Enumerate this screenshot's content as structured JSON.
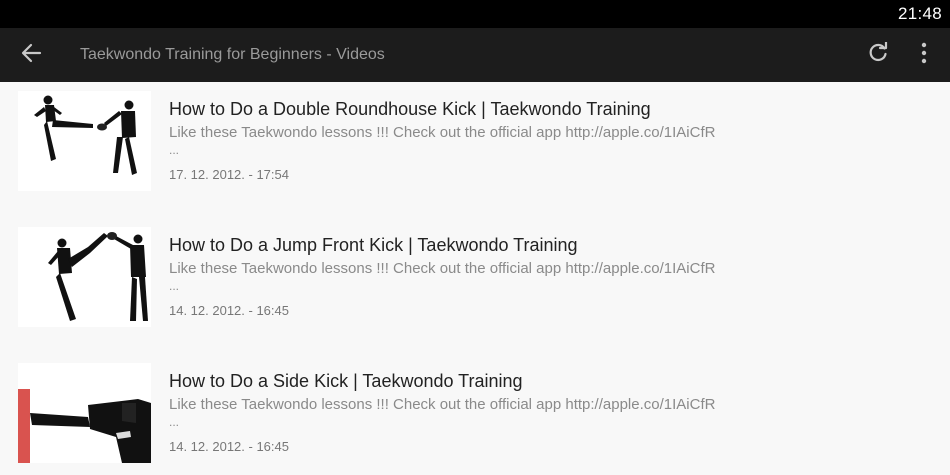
{
  "status_bar": {
    "time": "21:48"
  },
  "app_bar": {
    "back_icon": "arrow-left-icon",
    "title": "Taekwondo Training for Beginners - Videos",
    "refresh_icon": "refresh-icon",
    "overflow_icon": "more-vert-icon"
  },
  "colors": {
    "status_bar_bg": "#000000",
    "app_bar_bg": "#1c1c1c",
    "list_bg": "#f8f8f8"
  },
  "videos": [
    {
      "title": "How to Do a Double Roundhouse Kick | Taekwondo Training",
      "description": "Like these Taekwondo lessons !!! Check out the official app http://apple.co/1IAiCfR",
      "ellipsis": "...",
      "date": "17. 12. 2012. - 17:54"
    },
    {
      "title": "How to Do a Jump Front Kick | Taekwondo Training",
      "description": "Like these Taekwondo lessons !!! Check out the official app http://apple.co/1IAiCfR",
      "ellipsis": "...",
      "date": "14. 12. 2012. - 16:45"
    },
    {
      "title": "How to Do a Side Kick | Taekwondo Training",
      "description": "Like these Taekwondo lessons !!! Check out the official app http://apple.co/1IAiCfR",
      "ellipsis": "...",
      "date": "14. 12. 2012. - 16:45"
    }
  ]
}
